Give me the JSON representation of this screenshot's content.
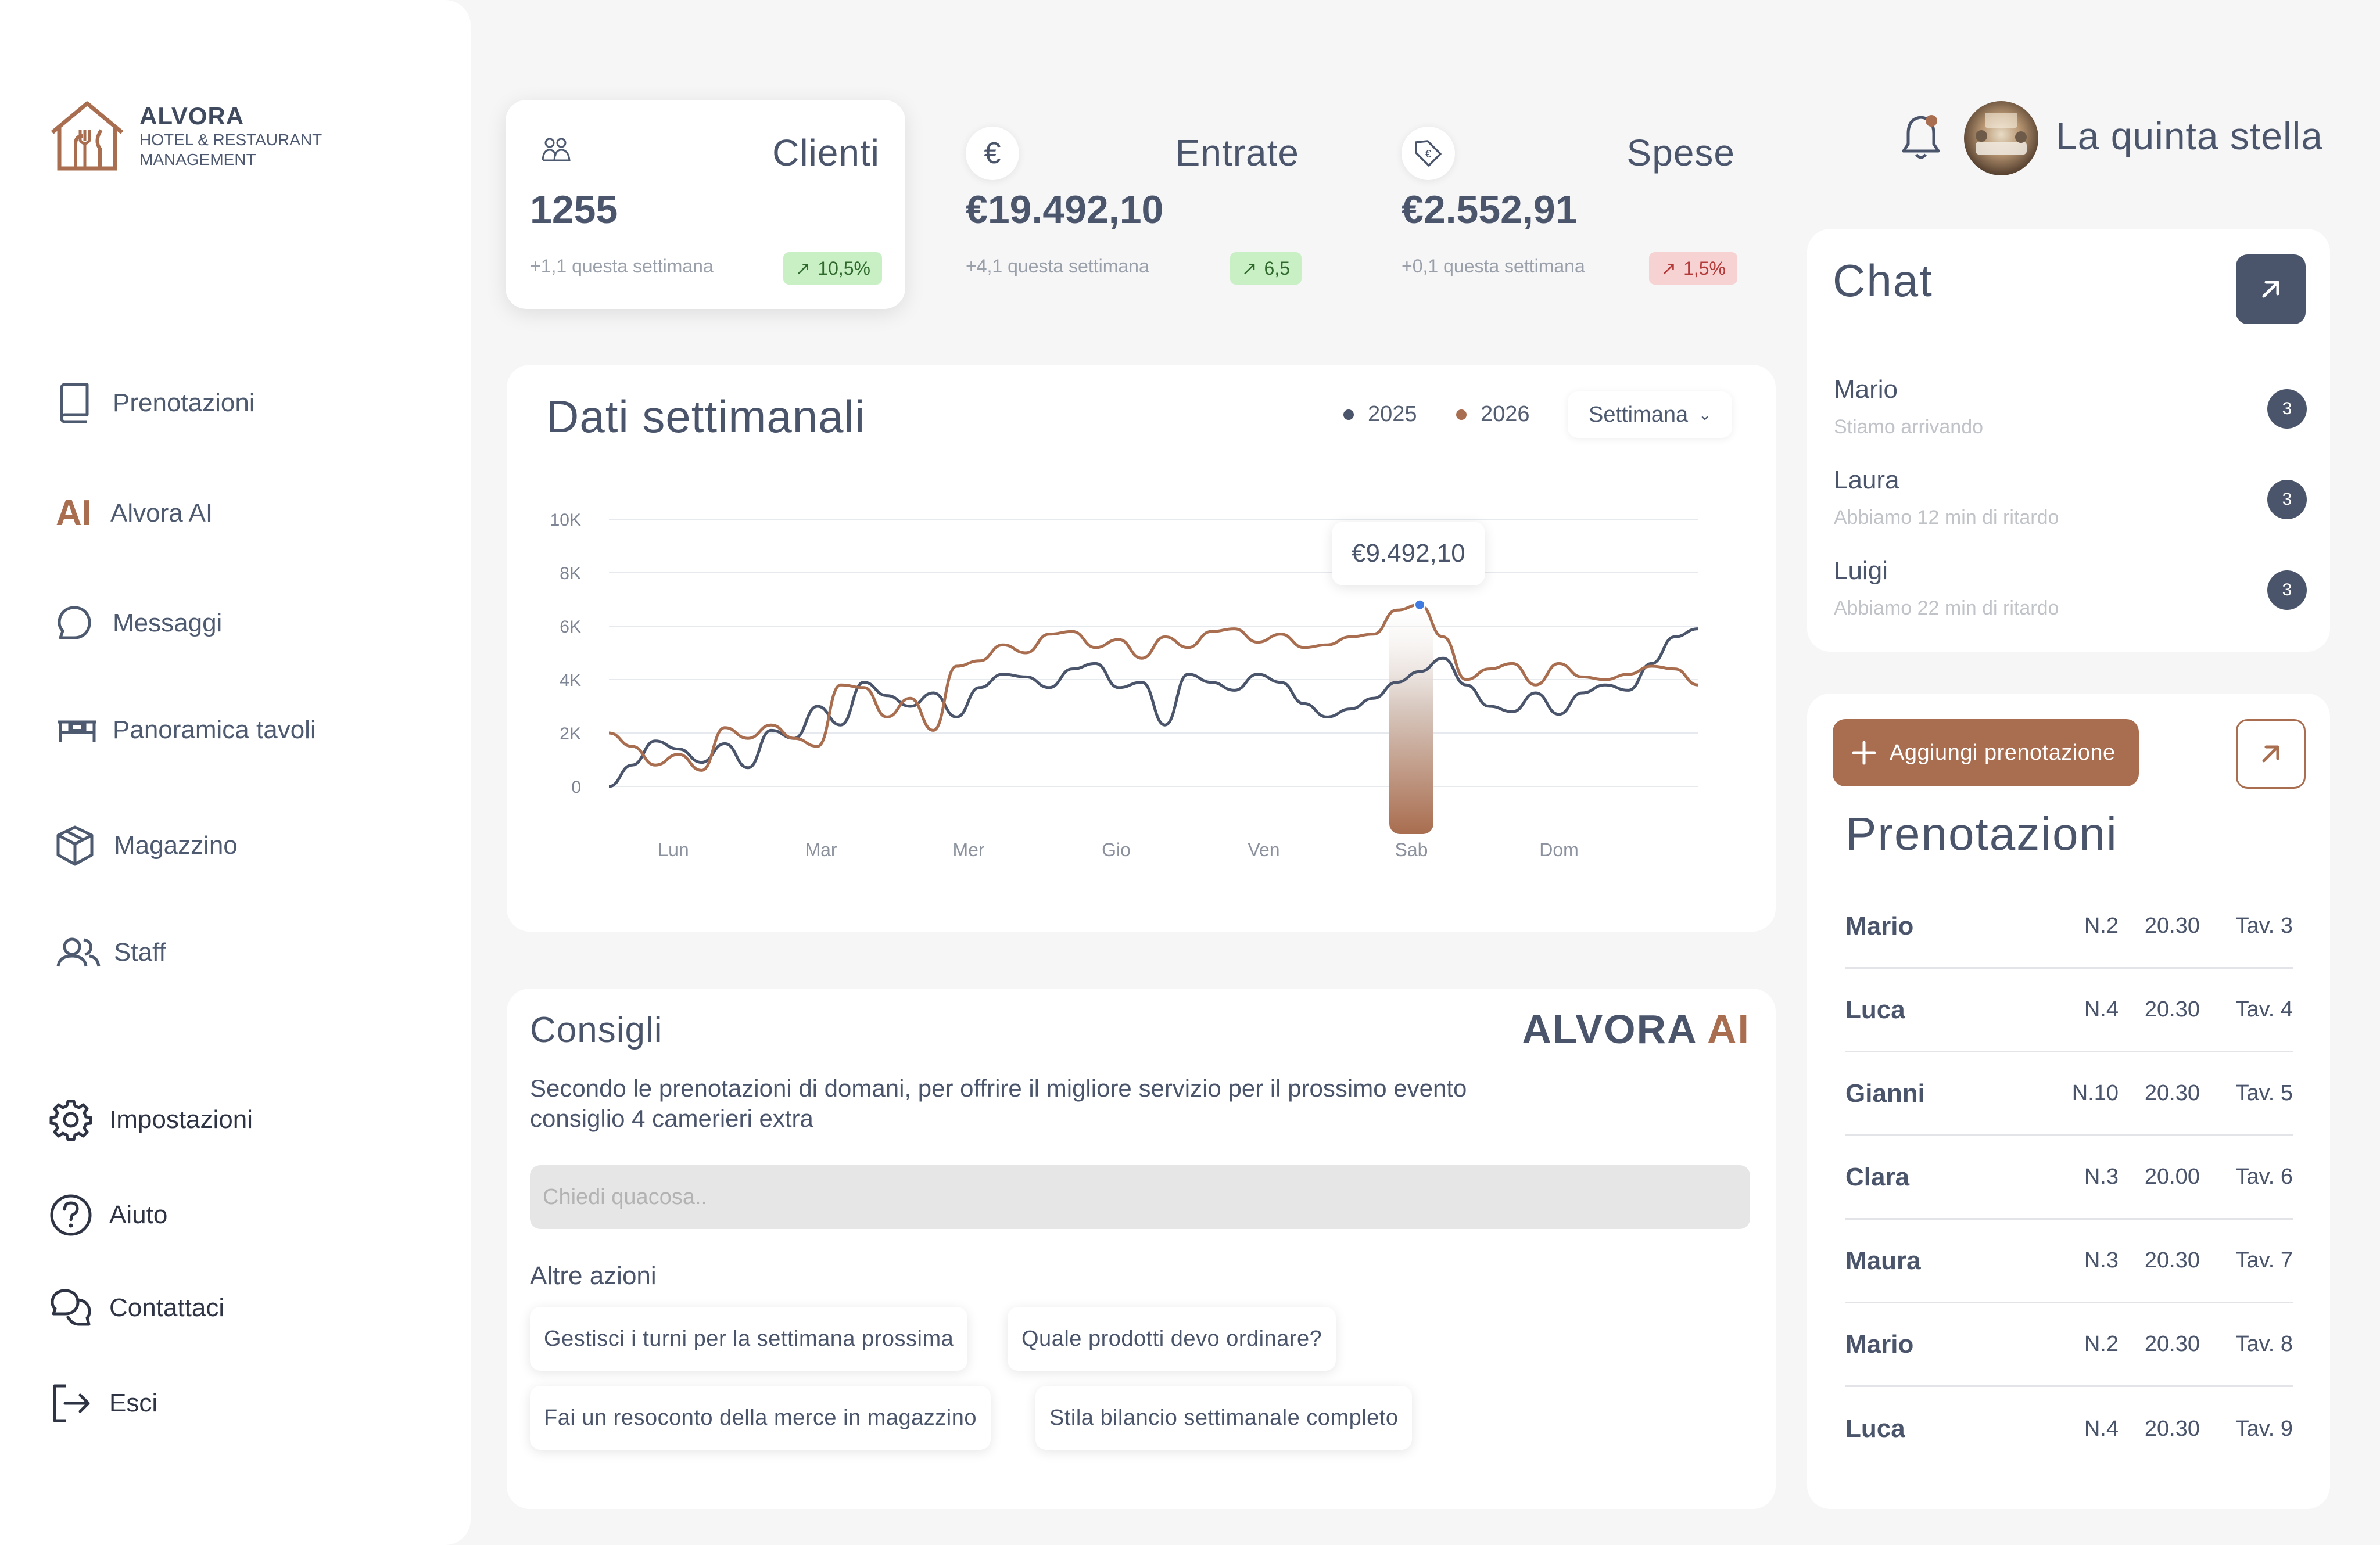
{
  "brand": {
    "name": "ALVORA",
    "subtitle_line1": "HOTEL & RESTAURANT",
    "subtitle_line2": "MANAGEMENT",
    "accent_color": "#a96d4f",
    "dark_color": "#4a556b"
  },
  "sidebar": {
    "nav": [
      {
        "label": "Prenotazioni",
        "icon": "book-icon"
      },
      {
        "label": "Alvora AI",
        "icon": "ai-icon"
      },
      {
        "label": "Messaggi",
        "icon": "chat-bubble-icon"
      },
      {
        "label": "Panoramica tavoli",
        "icon": "table-icon"
      },
      {
        "label": "Magazzino",
        "icon": "box-icon"
      },
      {
        "label": "Staff",
        "icon": "users-icon"
      }
    ],
    "ai_icon_text": "AI",
    "bottom": [
      {
        "label": "Impostazioni",
        "icon": "gear-icon"
      },
      {
        "label": "Aiuto",
        "icon": "help-icon"
      },
      {
        "label": "Contattaci",
        "icon": "chats-icon"
      },
      {
        "label": "Esci",
        "icon": "logout-icon"
      }
    ]
  },
  "stats": [
    {
      "title": "Clienti",
      "value": "1255",
      "week": "+1,1 questa settimana",
      "badge": "10,5%",
      "trend": "up",
      "icon": "users-icon"
    },
    {
      "title": "Entrate",
      "value": "€19.492,10",
      "week": "+4,1 questa settimana",
      "badge": "6,5",
      "trend": "up",
      "icon": "euro-icon",
      "icon_glyph": "€"
    },
    {
      "title": "Spese",
      "value": "€2.552,91",
      "week": "+0,1 questa settimana",
      "badge": "1,5%",
      "trend": "down",
      "icon": "price-tag-icon"
    }
  ],
  "header": {
    "user_name": "La quinta stella"
  },
  "weekly": {
    "title": "Dati settimanali",
    "legend": [
      {
        "label": "2025",
        "color": "#4a556b"
      },
      {
        "label": "2026",
        "color": "#a96d4f"
      }
    ],
    "period": "Settimana",
    "tooltip": "€9.492,10",
    "highlight_day": "Sab"
  },
  "chart_data": {
    "type": "line",
    "x": [
      "Lun",
      "Mar",
      "Mer",
      "Gio",
      "Ven",
      "Sab",
      "Dom"
    ],
    "yticks": [
      "10K",
      "8K",
      "6K",
      "4K",
      "2K",
      "0"
    ],
    "ylim": [
      0,
      10000
    ],
    "series": [
      {
        "name": "2025",
        "color": "#4a556b",
        "values": [
          0,
          800,
          1700,
          1400,
          900,
          1600,
          700,
          2100,
          1800,
          3000,
          2300,
          3900,
          3400,
          3000,
          3500,
          2600,
          3700,
          4200,
          4100,
          3700,
          4400,
          4600,
          3700,
          3900,
          2300,
          4200,
          3900,
          3600,
          4200,
          3900,
          3100,
          2600,
          2900,
          3300,
          3900,
          4300,
          4800,
          3800,
          3000,
          2800,
          3500,
          2700,
          3500,
          3800,
          3600,
          4600,
          5600,
          5900
        ]
      },
      {
        "name": "2026",
        "color": "#a96d4f",
        "values": [
          2000,
          1500,
          800,
          1200,
          600,
          2200,
          1800,
          2300,
          1800,
          1500,
          3800,
          3700,
          2600,
          3300,
          2100,
          4500,
          4700,
          5300,
          5000,
          5700,
          5800,
          5200,
          5500,
          4800,
          5600,
          5200,
          5800,
          5900,
          5400,
          5700,
          5200,
          5300,
          5600,
          5700,
          6600,
          6800,
          5600,
          4000,
          4400,
          4600,
          3800,
          4600,
          4100,
          4000,
          4200,
          4500,
          4400,
          3800
        ]
      }
    ]
  },
  "consigli": {
    "title": "Consigli",
    "brand_word": "ALVORA",
    "brand_ai": "AI",
    "text": "Secondo le prenotazioni di domani, per offrire il migliore servizio per il prossimo evento consiglio 4 camerieri extra",
    "input_placeholder": "Chiedi quacosa..",
    "other_title": "Altre azioni",
    "actions": [
      "Gestisci i turni per la settimana prossima",
      "Quale prodotti devo ordinare?",
      "Fai un resoconto della merce in magazzino",
      "Stila bilancio settimanale completo"
    ]
  },
  "chat": {
    "title": "Chat",
    "items": [
      {
        "name": "Mario",
        "message": "Stiamo arrivando",
        "count": "3"
      },
      {
        "name": "Laura",
        "message": "Abbiamo 12 min di ritardo",
        "count": "3"
      },
      {
        "name": "Luigi",
        "message": "Abbiamo 22 min di ritardo",
        "count": "3"
      }
    ]
  },
  "prenotazioni": {
    "add_label": "Aggiungi prenotazione",
    "title": "Prenotazioni",
    "rows": [
      {
        "name": "Mario",
        "people": "N.2",
        "time": "20.30",
        "table": "Tav. 3"
      },
      {
        "name": "Luca",
        "people": "N.4",
        "time": "20.30",
        "table": "Tav. 4"
      },
      {
        "name": "Gianni",
        "people": "N.10",
        "time": "20.30",
        "table": "Tav. 5"
      },
      {
        "name": "Clara",
        "people": "N.3",
        "time": "20.00",
        "table": "Tav. 6"
      },
      {
        "name": "Maura",
        "people": "N.3",
        "time": "20.30",
        "table": "Tav. 7"
      },
      {
        "name": "Mario",
        "people": "N.2",
        "time": "20.30",
        "table": "Tav. 8"
      },
      {
        "name": "Luca",
        "people": "N.4",
        "time": "20.30",
        "table": "Tav. 9"
      }
    ]
  }
}
